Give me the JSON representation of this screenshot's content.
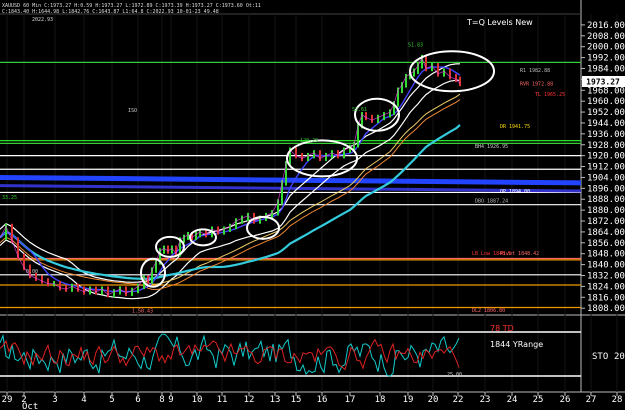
{
  "header": {
    "ohlc_line1": "XAUUSD 60 Min  C:1973.27  H:0.59  H:1973.27  L:1972.89  C:1973.39  H:1973.27  C:1973.60  Ot:11",
    "ohlc_line2": "C:1843.40  H:1644.98  L:1842.76  C:1643.87  L1:64.8  C:2022.93  10-01-23  49.48",
    "date_label": "2022.93"
  },
  "chart_title": "T=Q Levels New",
  "price_tag": "1973.27",
  "chart_data": [
    {
      "type": "line",
      "title": "T=Q Levels New",
      "ylim": [
        1803,
        2024
      ],
      "y_ticks": [
        2016.0,
        2008.0,
        2000.0,
        1992.0,
        1984.0,
        1976.0,
        1968.0,
        1960.0,
        1952.0,
        1944.0,
        1936.0,
        1928.0,
        1920.0,
        1912.0,
        1904.0,
        1896.0,
        1888.0,
        1880.0,
        1872.0,
        1864.0,
        1856.0,
        1848.0,
        1840.0,
        1832.0,
        1824.0,
        1816.0,
        1808.0
      ],
      "x_ticks": [
        "29",
        "2",
        "3",
        "4",
        "5",
        "6",
        "8",
        "9",
        "10",
        "11",
        "12",
        "13",
        "15",
        "16",
        "17",
        "18",
        "19",
        "20",
        "22",
        "23",
        "24",
        "25",
        "26",
        "27",
        "28"
      ],
      "x_sub_label": "Oct",
      "price_series": [
        [
          0,
          1860
        ],
        [
          6,
          1868
        ],
        [
          12,
          1858
        ],
        [
          18,
          1846
        ],
        [
          24,
          1838
        ],
        [
          30,
          1832
        ],
        [
          36,
          1830
        ],
        [
          42,
          1828
        ],
        [
          48,
          1826
        ],
        [
          54,
          1826
        ],
        [
          60,
          1823
        ],
        [
          66,
          1822
        ],
        [
          72,
          1824
        ],
        [
          78,
          1822
        ],
        [
          84,
          1820
        ],
        [
          90,
          1822
        ],
        [
          96,
          1820
        ],
        [
          102,
          1822
        ],
        [
          108,
          1818
        ],
        [
          114,
          1820
        ],
        [
          120,
          1822
        ],
        [
          126,
          1819
        ],
        [
          132,
          1821
        ],
        [
          138,
          1824
        ],
        [
          144,
          1830
        ],
        [
          148,
          1828
        ],
        [
          152,
          1836
        ],
        [
          156,
          1842
        ],
        [
          160,
          1850
        ],
        [
          164,
          1852
        ],
        [
          168,
          1850
        ],
        [
          172,
          1852
        ],
        [
          176,
          1848
        ],
        [
          180,
          1858
        ],
        [
          184,
          1860
        ],
        [
          188,
          1862
        ],
        [
          192,
          1860
        ],
        [
          196,
          1862
        ],
        [
          200,
          1864
        ],
        [
          206,
          1862
        ],
        [
          212,
          1866
        ],
        [
          218,
          1864
        ],
        [
          224,
          1866
        ],
        [
          230,
          1868
        ],
        [
          236,
          1872
        ],
        [
          242,
          1874
        ],
        [
          248,
          1876
        ],
        [
          254,
          1872
        ],
        [
          260,
          1874
        ],
        [
          266,
          1876
        ],
        [
          272,
          1878
        ],
        [
          278,
          1886
        ],
        [
          282,
          1900
        ],
        [
          286,
          1914
        ],
        [
          290,
          1924
        ],
        [
          296,
          1920
        ],
        [
          302,
          1918
        ],
        [
          308,
          1920
        ],
        [
          314,
          1922
        ],
        [
          320,
          1918
        ],
        [
          326,
          1920
        ],
        [
          332,
          1922
        ],
        [
          338,
          1920
        ],
        [
          344,
          1924
        ],
        [
          350,
          1926
        ],
        [
          354,
          1928
        ],
        [
          358,
          1942
        ],
        [
          362,
          1950
        ],
        [
          366,
          1948
        ],
        [
          372,
          1946
        ],
        [
          378,
          1948
        ],
        [
          384,
          1950
        ],
        [
          390,
          1952
        ],
        [
          394,
          1958
        ],
        [
          398,
          1968
        ],
        [
          402,
          1972
        ],
        [
          406,
          1978
        ],
        [
          410,
          1980
        ],
        [
          414,
          1982
        ],
        [
          418,
          1986
        ],
        [
          422,
          1992
        ],
        [
          426,
          1984
        ],
        [
          432,
          1986
        ],
        [
          438,
          1980
        ],
        [
          444,
          1982
        ],
        [
          450,
          1978
        ],
        [
          456,
          1976
        ],
        [
          460,
          1973
        ]
      ],
      "level_lines": [
        {
          "value": 1988.5,
          "color": "#3c3"
        },
        {
          "value": 1931,
          "color": "#3f3"
        },
        {
          "value": 1929,
          "color": "#3c3"
        },
        {
          "value": 1920,
          "color": "#fff"
        },
        {
          "value": 1910,
          "color": "#fff"
        },
        {
          "value": 1893,
          "color": "#fff"
        },
        {
          "value": 1884,
          "color": "#fff"
        },
        {
          "value": 1844.5,
          "color": "#f66"
        },
        {
          "value": 1843.5,
          "color": "#e90"
        },
        {
          "value": 1832.5,
          "color": "#fff"
        },
        {
          "value": 1825,
          "color": "#e90"
        },
        {
          "value": 1808.5,
          "color": "#e90"
        }
      ],
      "level_labels": [
        {
          "text": "R1 1982.88",
          "value": 1982.88,
          "color": "#bbb"
        },
        {
          "text": "RVR 1972.88",
          "value": 1972.88,
          "color": "#f66"
        },
        {
          "text": "TL 1965.25",
          "value": 1965.25,
          "color": "#f33"
        },
        {
          "text": "DR 1941.75",
          "value": 1941.75,
          "color": "#fd0"
        },
        {
          "text": "BH4 1926.95",
          "value": 1926.95,
          "color": "#ccc"
        },
        {
          "text": "OP 1894.00",
          "value": 1894.0,
          "color": "#fff"
        },
        {
          "text": "DBO 1887.24",
          "value": 1887.24,
          "color": "#bbb"
        },
        {
          "text": "LB Low 1848.5",
          "value": 1848.5,
          "color": "#f33"
        },
        {
          "text": "Pivot 1848.42",
          "value": 1848.42,
          "color": "#f66"
        },
        {
          "text": "DL2 1806.80",
          "value": 1806.8,
          "color": "#f66"
        }
      ],
      "chart_notes": [
        {
          "text": "51.83",
          "value": 2000,
          "color": "#3c3"
        },
        {
          "text": "52.61",
          "value": 1952.6,
          "color": "#3c3"
        },
        {
          "text": "120.29",
          "value": 1930,
          "color": "#3c3"
        },
        {
          "text": "1.50.43",
          "value": 1805,
          "color": "#f66"
        },
        {
          "text": "ISO",
          "value": 1952,
          "color": "#ccc"
        },
        {
          "text": "33.25",
          "value": 1888,
          "color": "#3c3"
        },
        {
          "text": "0.00",
          "value": 1834,
          "color": "#ccc"
        }
      ]
    },
    {
      "type": "line",
      "title": "",
      "series_colors": [
        "#1cc",
        "#d22"
      ],
      "indicator_line1": "78 TD",
      "indicator_line2": "1844 YRange",
      "axis_label": "STO",
      "axis_value": "20",
      "small_value": "25.00"
    }
  ]
}
